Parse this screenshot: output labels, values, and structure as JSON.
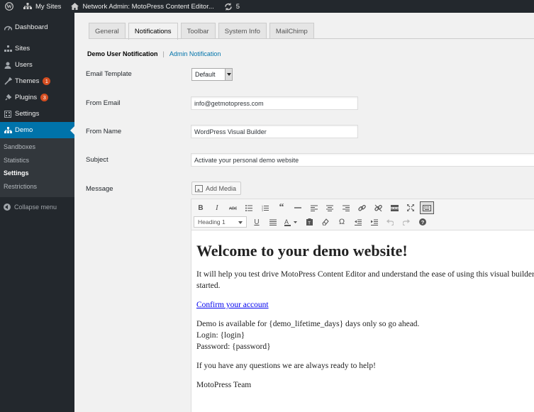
{
  "adminbar": {
    "my_sites": "My Sites",
    "network_admin": "Network Admin: MotoPress Content Editor...",
    "updates_count": "5"
  },
  "sidebar": {
    "items": [
      {
        "label": "Dashboard",
        "icon": "dashboard-icon"
      },
      {
        "label": "Sites",
        "icon": "sites-icon"
      },
      {
        "label": "Users",
        "icon": "users-icon"
      },
      {
        "label": "Themes",
        "icon": "themes-icon",
        "badge": "1"
      },
      {
        "label": "Plugins",
        "icon": "plugins-icon",
        "badge": "3"
      },
      {
        "label": "Settings",
        "icon": "settings-icon"
      },
      {
        "label": "Demo",
        "icon": "demo-icon"
      }
    ],
    "submenu": [
      "Sandboxes",
      "Statistics",
      "Settings",
      "Restrictions"
    ],
    "collapse": "Collapse menu"
  },
  "tabs": [
    "General",
    "Notifications",
    "Toolbar",
    "System Info",
    "MailChimp"
  ],
  "subsub": {
    "current": "Demo User Notification",
    "separator": "|",
    "other": "Admin Notification"
  },
  "form": {
    "email_template_label": "Email Template",
    "email_template_value": "Default",
    "from_email_label": "From Email",
    "from_email_value": "info@getmotopress.com",
    "from_name_label": "From Name",
    "from_name_value": "WordPress Visual Builder",
    "subject_label": "Subject",
    "subject_value": "Activate your personal demo website",
    "message_label": "Message",
    "add_media": "Add Media"
  },
  "editor": {
    "format_select": "Heading 1",
    "heading": "Welcome to your demo website!",
    "para1_line1": "It will help you test drive MotoPress Content Editor and understand the ease of using this visual builder",
    "para1_line2": "started.",
    "link": "Confirm your account",
    "para2_line1": "Demo is available for {demo_lifetime_days} days only so go ahead.",
    "para2_line2": "Login: {login}",
    "para2_line3": "Password: {password}",
    "para3": "If you have any questions we are always ready to help!",
    "signature": "MotoPress Team"
  },
  "colors": {
    "adminbar_bg": "#23282d",
    "accent": "#0073aa",
    "badge": "#d54e21"
  }
}
